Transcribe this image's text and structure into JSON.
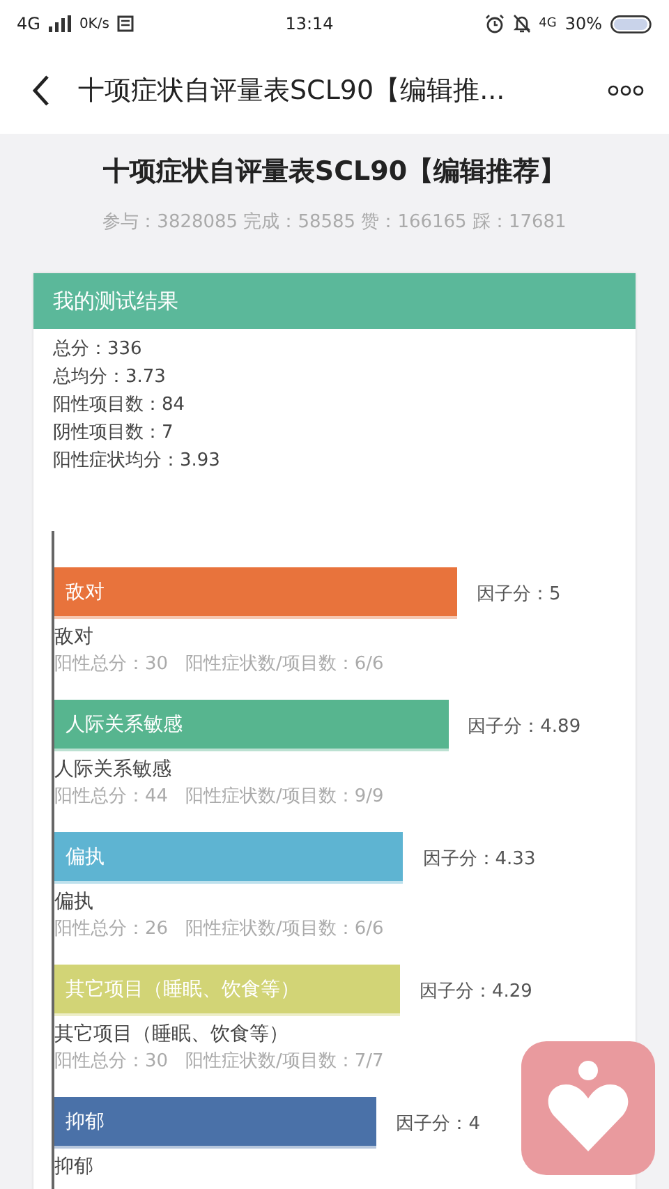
{
  "status_bar": {
    "network": "4G",
    "speed": "0K/s",
    "time": "13:14",
    "network_right": "4G",
    "battery": "30%"
  },
  "nav": {
    "title": "十项症状自评量表SCL90【编辑推..."
  },
  "header": {
    "title": "十项症状自评量表SCL90【编辑推荐】",
    "stats": "参与：3828085 完成：58585 赞：166165 踩：17681"
  },
  "result_card": {
    "title": "我的测试结果",
    "summary": [
      "总分：336",
      "总均分：3.73",
      "阳性项目数：84",
      "阴性项目数：7",
      "阳性症状均分：3.93"
    ],
    "factors": [
      {
        "color": "#e8733c",
        "name": "敌对",
        "detail": "阳性总分：30   阳性症状数/项目数：6/6"
      },
      {
        "color": "#57b58f",
        "name": "人际关系敏感",
        "detail": "阳性总分：44   阳性症状数/项目数：9/9"
      },
      {
        "color": "#5eb4d2",
        "name": "偏执",
        "detail": "阳性总分：26   阳性症状数/项目数：6/6"
      },
      {
        "color": "#d2d476",
        "name": "其它项目（睡眠、饮食等）",
        "detail": "阳性总分：30   阳性症状数/项目数：7/7"
      },
      {
        "color": "#4a71a8",
        "name": "抑郁"
      }
    ],
    "chart_data": {
      "type": "bar",
      "orientation": "horizontal",
      "categories": [
        "敌对",
        "人际关系敏感",
        "偏执",
        "其它项目（睡眠、饮食等）",
        "抑郁"
      ],
      "values": [
        5,
        4.89,
        4.33,
        4.29,
        4
      ],
      "value_labels": [
        "因子分：5",
        "因子分：4.89",
        "因子分：4.33",
        "因子分：4.29",
        "因子分：4"
      ]
    }
  }
}
